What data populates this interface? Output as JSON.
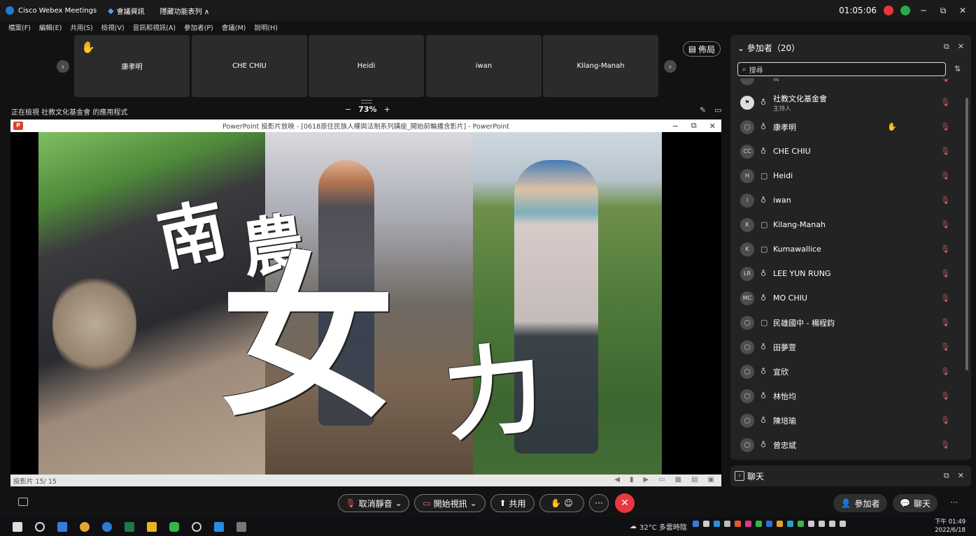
{
  "titlebar": {
    "app_name": "Cisco Webex Meetings",
    "meeting_info": "會議資訊",
    "hidden_menu": "隱藏功能表列 ∧",
    "time": "01:05:06",
    "minimize": "−",
    "restore": "⧉",
    "close": "✕"
  },
  "menubar": [
    "檔案(F)",
    "編輯(E)",
    "共用(S)",
    "檢視(V)",
    "音訊和視訊(A)",
    "參加者(P)",
    "會議(M)",
    "說明(H)"
  ],
  "filmstrip": {
    "prev": "‹",
    "next": "›",
    "tiles": [
      "康孝明",
      "CHE CHIU",
      "Heidi",
      "iwan",
      "Kilang-Manah"
    ],
    "layout_label": "佈局"
  },
  "viewing": {
    "text": "正在檢視 社教文化基金會 的應用程式",
    "zoom_minus": "−",
    "zoom_pct": "73%",
    "zoom_plus": "+"
  },
  "ppt": {
    "title": "PowerPoint 投影片放映 - [0618原住民族人權與法制系列講座_開始前輪播含影片] - PowerPoint",
    "status": "投影片 15/ 15",
    "slide_text": [
      "南",
      "農",
      "女",
      "力"
    ]
  },
  "controls": {
    "unmute": "取消靜音",
    "start_video": "開始視訊",
    "share": "共用",
    "more": "···",
    "end": "✕",
    "participants": "參加者",
    "chat": "聊天"
  },
  "participants_panel": {
    "header": "參加者（20）",
    "search_placeholder": "搜尋",
    "list": [
      {
        "initials": "",
        "name": "我",
        "sub": "",
        "device": "",
        "muted": true
      },
      {
        "initials": "",
        "name": "社教文化基金會",
        "sub": "主持人",
        "device": "phone",
        "muted": true,
        "host": true
      },
      {
        "initials": "",
        "name": "康孝明",
        "sub": "",
        "device": "phone",
        "muted": true,
        "raised_hand": true
      },
      {
        "initials": "CC",
        "name": "CHE CHIU",
        "sub": "",
        "device": "phone",
        "muted": true
      },
      {
        "initials": "H",
        "name": "Heidi",
        "sub": "",
        "device": "screen",
        "muted": true
      },
      {
        "initials": "I",
        "name": "iwan",
        "sub": "",
        "device": "phone",
        "muted": true
      },
      {
        "initials": "K",
        "name": "Kilang-Manah",
        "sub": "",
        "device": "screen",
        "muted": true
      },
      {
        "initials": "K",
        "name": "Kumawallice",
        "sub": "",
        "device": "screen",
        "muted": true
      },
      {
        "initials": "LR",
        "name": "LEE YUN RUNG",
        "sub": "",
        "device": "phone",
        "muted": true
      },
      {
        "initials": "MC",
        "name": "MO CHIU",
        "sub": "",
        "device": "phone",
        "muted": true
      },
      {
        "initials": "",
        "name": "民雄國中 - 楊程鈞",
        "sub": "",
        "device": "screen",
        "muted": true
      },
      {
        "initials": "",
        "name": "田夢萱",
        "sub": "",
        "device": "phone",
        "muted": true
      },
      {
        "initials": "",
        "name": "宜欣",
        "sub": "",
        "device": "phone",
        "muted": true
      },
      {
        "initials": "",
        "name": "林怡均",
        "sub": "",
        "device": "phone",
        "muted": true
      },
      {
        "initials": "",
        "name": "陳培瑜",
        "sub": "",
        "device": "phone",
        "muted": true
      },
      {
        "initials": "",
        "name": "曾忠斌",
        "sub": "",
        "device": "phone",
        "muted": true
      }
    ]
  },
  "chat_panel": {
    "label": "聊天"
  },
  "taskbar": {
    "weather": "32°C 多雲時陰",
    "time": "下午 01:49",
    "date": "2022/6/18"
  },
  "colors": {
    "accent": "#1e7bd9",
    "end_red": "#e8383d",
    "mute_red": "#e05a5a"
  }
}
